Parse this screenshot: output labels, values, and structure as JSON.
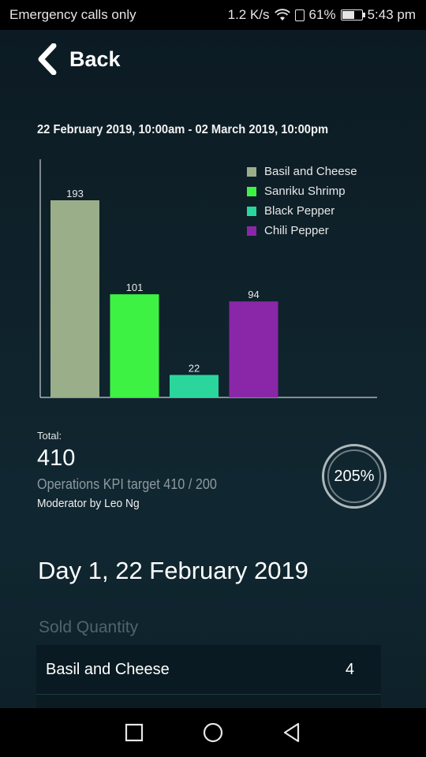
{
  "status_bar": {
    "carrier_text": "Emergency calls only",
    "network_speed": "1.2 K/s",
    "battery_percent": "61%",
    "battery_level": 0.61,
    "time": "5:43 pm"
  },
  "header": {
    "back_label": "Back"
  },
  "date_range": "22 February 2019, 10:00am - 02 March 2019, 10:00pm",
  "chart_data": {
    "type": "bar",
    "categories": [
      "Basil and Cheese",
      "Sanriku Shrimp",
      "Black Pepper",
      "Chili Pepper"
    ],
    "values": [
      193,
      101,
      22,
      94
    ],
    "value_labels": [
      "193",
      "101",
      "22",
      "94"
    ],
    "colors": [
      "#9aae8a",
      "#3ef244",
      "#2ad69c",
      "#8a27a8"
    ],
    "legend_placement": "top-right",
    "grid": false,
    "ylim": [
      0,
      193
    ]
  },
  "summary": {
    "total_label": "Total:",
    "total_value": "410",
    "kpi_text": "Operations KPI target 410 / 200",
    "moderator_text": "Moderator by Leo Ng",
    "kpi_percent": "205%"
  },
  "day_section": {
    "title": "Day 1, 22 February 2019",
    "sold_quantity_label": "Sold Quantity",
    "rows": [
      {
        "name": "Basil and Cheese",
        "quantity": "4"
      }
    ]
  }
}
